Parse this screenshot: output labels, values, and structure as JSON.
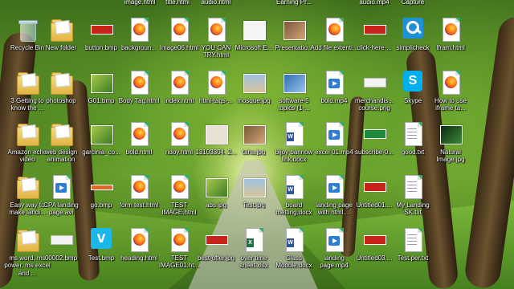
{
  "desktop": {
    "top_row_clipped": [
      "image.html",
      "title.html",
      "audio.html",
      "Earning Pr...",
      "audio.mp4",
      "Capture"
    ],
    "icons": [
      {
        "col": 0,
        "row": 0,
        "label": "Recycle Bin",
        "type": "bin"
      },
      {
        "col": 1,
        "row": 0,
        "label": "New folder",
        "type": "folder"
      },
      {
        "col": 2,
        "row": 0,
        "label": "button.bmp",
        "type": "banner-red"
      },
      {
        "col": 3,
        "row": 0,
        "label": "backgroun...",
        "type": "firefox"
      },
      {
        "col": 4,
        "row": 0,
        "label": "Image06.html",
        "type": "firefox"
      },
      {
        "col": 5,
        "row": 0,
        "label": "YOU CAN TRY.html",
        "type": "firefox"
      },
      {
        "col": 6,
        "row": 0,
        "label": "Microsoft E...",
        "type": "image-white"
      },
      {
        "col": 7,
        "row": 0,
        "label": "Presentatio...",
        "type": "image-photo"
      },
      {
        "col": 8,
        "row": 0,
        "label": "Add file extenti...",
        "type": "firefox"
      },
      {
        "col": 9,
        "row": 0,
        "label": "click-here-...",
        "type": "banner-red"
      },
      {
        "col": 10,
        "row": 0,
        "label": "simplicheck",
        "type": "simplicheck"
      },
      {
        "col": 11,
        "row": 0,
        "label": "Ifram.html",
        "type": "firefox"
      },
      {
        "col": 0,
        "row": 1,
        "label": "3 Getting to know the ...",
        "type": "folder"
      },
      {
        "col": 1,
        "row": 1,
        "label": "photoshop",
        "type": "folder"
      },
      {
        "col": 2,
        "row": 1,
        "label": "G01.bmp",
        "type": "image-green"
      },
      {
        "col": 3,
        "row": 1,
        "label": "Body Tag.html",
        "type": "firefox"
      },
      {
        "col": 4,
        "row": 1,
        "label": "index.html",
        "type": "firefox"
      },
      {
        "col": 5,
        "row": 1,
        "label": "html-tags-...",
        "type": "firefox"
      },
      {
        "col": 6,
        "row": 1,
        "label": "mosque.jpg",
        "type": "image-mosque"
      },
      {
        "col": 7,
        "row": 1,
        "label": "software-5 topics (1-...",
        "type": "image-blue"
      },
      {
        "col": 8,
        "row": 1,
        "label": "bold.mp4",
        "type": "media"
      },
      {
        "col": 9,
        "row": 1,
        "label": "merchandis... course.png",
        "type": "banner-white"
      },
      {
        "col": 10,
        "row": 1,
        "label": "Skype",
        "type": "skype"
      },
      {
        "col": 11,
        "row": 1,
        "label": "How to use iframe ta...",
        "type": "firefox"
      },
      {
        "col": 0,
        "row": 2,
        "label": "Amazon echo video",
        "type": "folder"
      },
      {
        "col": 1,
        "row": 2,
        "label": "web design animation",
        "type": "folder"
      },
      {
        "col": 2,
        "row": 2,
        "label": "garcinia_co...",
        "type": "image-green"
      },
      {
        "col": 3,
        "row": 2,
        "label": "bold.html",
        "type": "firefox"
      },
      {
        "col": 4,
        "row": 2,
        "label": "ridoy.html",
        "type": "firefox"
      },
      {
        "col": 5,
        "row": 2,
        "label": "13103304_2...",
        "type": "image-paper"
      },
      {
        "col": 6,
        "row": 2,
        "label": "taha.jpg",
        "type": "image-photo"
      },
      {
        "col": 7,
        "row": 2,
        "label": "bijoy bannow link.docx",
        "type": "word"
      },
      {
        "col": 8,
        "row": 2,
        "label": "excel 01.mp4",
        "type": "media"
      },
      {
        "col": 9,
        "row": 2,
        "label": "subscribe-0...",
        "type": "banner-green"
      },
      {
        "col": 10,
        "row": 2,
        "label": "good.txt",
        "type": "txt"
      },
      {
        "col": 11,
        "row": 2,
        "label": "Natural Image.jpg",
        "type": "image-dark"
      },
      {
        "col": 0,
        "row": 3,
        "label": "Easy way to make landi...",
        "type": "folder"
      },
      {
        "col": 1,
        "row": 3,
        "label": "CPA landing page.avi",
        "type": "media"
      },
      {
        "col": 2,
        "row": 3,
        "label": "go.bmp",
        "type": "banner-orange"
      },
      {
        "col": 3,
        "row": 3,
        "label": "form test.html",
        "type": "firefox"
      },
      {
        "col": 4,
        "row": 3,
        "label": "TEST IMAGE.html",
        "type": "firefox"
      },
      {
        "col": 5,
        "row": 3,
        "label": "abs.jpg",
        "type": "image-green"
      },
      {
        "col": 6,
        "row": 3,
        "label": "Test.jpg",
        "type": "image-mosque"
      },
      {
        "col": 7,
        "row": 3,
        "label": "board metting.docx",
        "type": "word"
      },
      {
        "col": 8,
        "row": 3,
        "label": "landing page with html....",
        "type": "media"
      },
      {
        "col": 9,
        "row": 3,
        "label": "Untitled01....",
        "type": "banner-red"
      },
      {
        "col": 10,
        "row": 3,
        "label": "My Landing SK.txt",
        "type": "txt"
      },
      {
        "col": 0,
        "row": 4,
        "label": "ms word, ms power, ms excel and ...",
        "type": "folder"
      },
      {
        "col": 1,
        "row": 4,
        "label": "00002.bmp",
        "type": "banner-white"
      },
      {
        "col": 2,
        "row": 4,
        "label": "Test.bmp",
        "type": "vimeo"
      },
      {
        "col": 3,
        "row": 4,
        "label": "heading.html",
        "type": "firefox"
      },
      {
        "col": 4,
        "row": 4,
        "label": "TEST IMAGE01.ht...",
        "type": "firefox"
      },
      {
        "col": 5,
        "row": 4,
        "label": "best-offer.jpg",
        "type": "banner-red"
      },
      {
        "col": 6,
        "row": 4,
        "label": "over time sheet.xlsx",
        "type": "excel"
      },
      {
        "col": 7,
        "row": 4,
        "label": "Class Module.docx",
        "type": "word"
      },
      {
        "col": 8,
        "row": 4,
        "label": "landing page.mp4",
        "type": "media"
      },
      {
        "col": 9,
        "row": 4,
        "label": "Untitled03....",
        "type": "banner-red"
      },
      {
        "col": 10,
        "row": 4,
        "label": "Test.per.txt",
        "type": "txt"
      }
    ]
  }
}
